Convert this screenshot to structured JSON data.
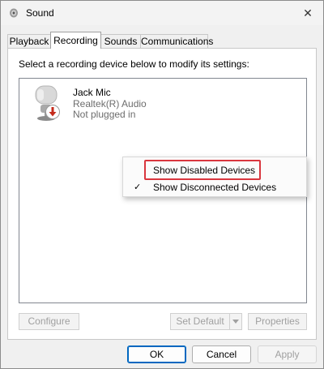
{
  "window": {
    "title": "Sound",
    "icon": "speaker-icon",
    "close_glyph": "✕"
  },
  "tabs": [
    {
      "label": "Playback",
      "active": false
    },
    {
      "label": "Recording",
      "active": true
    },
    {
      "label": "Sounds",
      "active": false
    },
    {
      "label": "Communications",
      "active": false
    }
  ],
  "panel": {
    "instruction": "Select a recording device below to modify its settings:"
  },
  "devices": [
    {
      "name": "Jack Mic",
      "driver": "Realtek(R) Audio",
      "status": "Not plugged in",
      "icon": "microphone-icon",
      "badge": "unplugged-arrow-icon"
    }
  ],
  "context_menu": {
    "items": [
      {
        "label": "Show Disabled Devices",
        "checked": false
      },
      {
        "label": "Show Disconnected Devices",
        "checked": true,
        "check_glyph": "✓"
      }
    ]
  },
  "device_buttons": {
    "configure": "Configure",
    "set_default": "Set Default",
    "properties": "Properties"
  },
  "dialog_buttons": {
    "ok": "OK",
    "cancel": "Cancel",
    "apply": "Apply"
  },
  "colors": {
    "highlight_box": "#d9363e",
    "unplugged_badge": "#c42b1c"
  }
}
